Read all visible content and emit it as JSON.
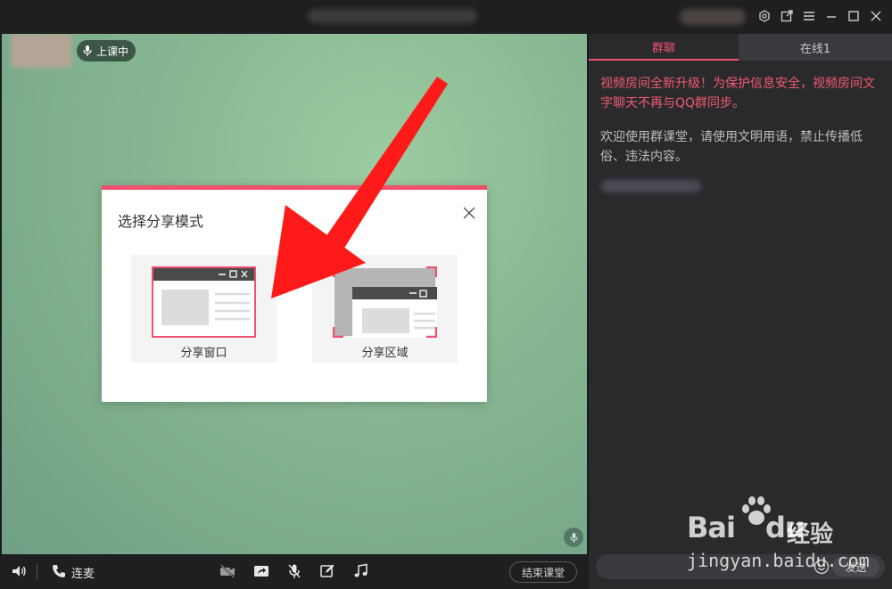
{
  "window": {
    "controls": [
      "settings-icon",
      "popout-icon",
      "menu-icon",
      "minimize-icon",
      "maximize-icon",
      "close-icon"
    ]
  },
  "stage": {
    "status_label": "上课中"
  },
  "dialog": {
    "title": "选择分享模式",
    "options": [
      {
        "label": "分享窗口",
        "icon": "window-share-icon"
      },
      {
        "label": "分享区域",
        "icon": "region-share-icon"
      }
    ]
  },
  "toolbar": {
    "connect_label": "连麦",
    "end_class_label": "结束课堂"
  },
  "panel": {
    "tabs": [
      {
        "label": "群聊",
        "active": true
      },
      {
        "label": "在线1",
        "active": false
      }
    ],
    "notice": "视频房间全新升级！为保护信息安全，视频房间文字聊天不再与QQ群同步。",
    "welcome": "欢迎使用群课堂，请使用文明用语，禁止传播低俗、违法内容。",
    "send_label": "发送"
  },
  "watermark": {
    "logo": "Bai",
    "logo_tail": "du",
    "cn": "经验",
    "url": "jingyan.baidu.com"
  },
  "colors": {
    "accent": "#f0506e",
    "panel_bg": "#2a2a2d",
    "toolbar_bg": "#1f1f21"
  }
}
